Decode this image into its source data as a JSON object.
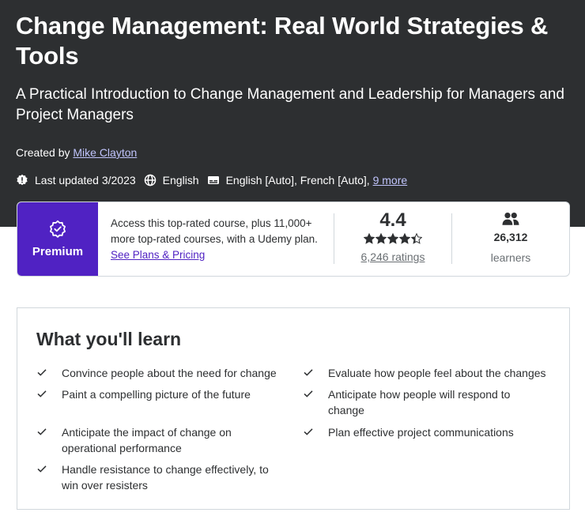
{
  "course": {
    "title": "Change Management: Real World Strategies & Tools",
    "subtitle": "A Practical Introduction to Change Management and Leadership for Managers and Project Managers",
    "created_by_label": "Created by",
    "instructor": "Mike Clayton",
    "last_updated": "Last updated 3/2023",
    "language": "English",
    "captions": "English [Auto], French [Auto],",
    "captions_more": "9 more"
  },
  "plan": {
    "badge_label": "Premium",
    "text": "Access this top-rated course, plus 11,000+ more top-rated courses, with a Udemy plan.",
    "link": "See Plans & Pricing",
    "rating": "4.4",
    "rating_stars": 4.4,
    "ratings_count": "6,246 ratings",
    "learners_count": "26,312",
    "learners_label": "learners"
  },
  "learn": {
    "title": "What you'll learn",
    "items": [
      "Convince people about the need for change",
      "Evaluate how people feel about the changes",
      "Paint a compelling picture of the future",
      "Anticipate how people will respond to change",
      "Anticipate the impact of change on operational performance",
      "Plan effective project communications",
      "Handle resistance to change effectively, to win over resisters"
    ]
  },
  "colors": {
    "hero_bg": "#2d2f31",
    "premium_purple": "#5022c3",
    "link_light": "#c0c4fc",
    "star": "#2d2f31"
  },
  "icons": [
    "alert-badge-icon",
    "globe-icon",
    "captions-icon",
    "premium-badge-icon",
    "star-icon",
    "users-icon",
    "check-icon"
  ]
}
